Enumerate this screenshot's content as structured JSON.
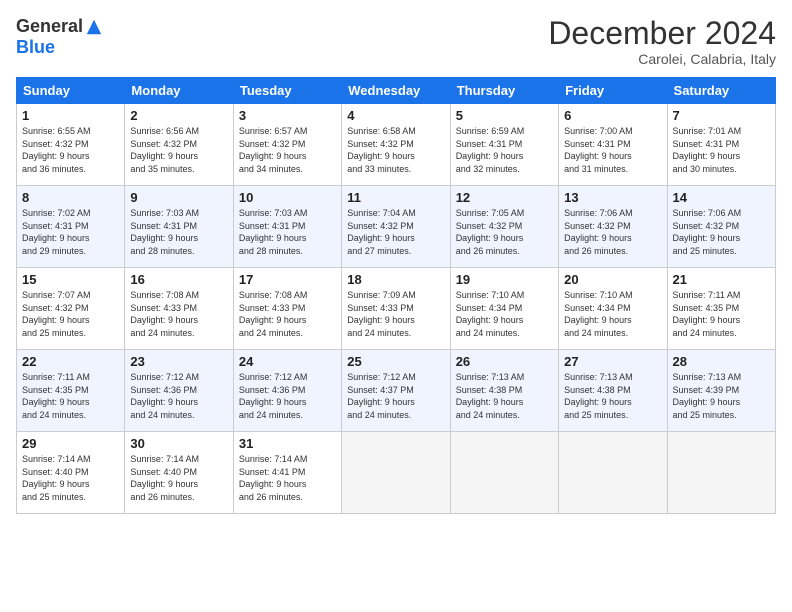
{
  "header": {
    "logo_general": "General",
    "logo_blue": "Blue",
    "month_title": "December 2024",
    "location": "Carolei, Calabria, Italy"
  },
  "days_of_week": [
    "Sunday",
    "Monday",
    "Tuesday",
    "Wednesday",
    "Thursday",
    "Friday",
    "Saturday"
  ],
  "weeks": [
    {
      "stripe": false,
      "days": [
        {
          "num": "1",
          "info": "Sunrise: 6:55 AM\nSunset: 4:32 PM\nDaylight: 9 hours\nand 36 minutes."
        },
        {
          "num": "2",
          "info": "Sunrise: 6:56 AM\nSunset: 4:32 PM\nDaylight: 9 hours\nand 35 minutes."
        },
        {
          "num": "3",
          "info": "Sunrise: 6:57 AM\nSunset: 4:32 PM\nDaylight: 9 hours\nand 34 minutes."
        },
        {
          "num": "4",
          "info": "Sunrise: 6:58 AM\nSunset: 4:32 PM\nDaylight: 9 hours\nand 33 minutes."
        },
        {
          "num": "5",
          "info": "Sunrise: 6:59 AM\nSunset: 4:31 PM\nDaylight: 9 hours\nand 32 minutes."
        },
        {
          "num": "6",
          "info": "Sunrise: 7:00 AM\nSunset: 4:31 PM\nDaylight: 9 hours\nand 31 minutes."
        },
        {
          "num": "7",
          "info": "Sunrise: 7:01 AM\nSunset: 4:31 PM\nDaylight: 9 hours\nand 30 minutes."
        }
      ]
    },
    {
      "stripe": true,
      "days": [
        {
          "num": "8",
          "info": "Sunrise: 7:02 AM\nSunset: 4:31 PM\nDaylight: 9 hours\nand 29 minutes."
        },
        {
          "num": "9",
          "info": "Sunrise: 7:03 AM\nSunset: 4:31 PM\nDaylight: 9 hours\nand 28 minutes."
        },
        {
          "num": "10",
          "info": "Sunrise: 7:03 AM\nSunset: 4:31 PM\nDaylight: 9 hours\nand 28 minutes."
        },
        {
          "num": "11",
          "info": "Sunrise: 7:04 AM\nSunset: 4:32 PM\nDaylight: 9 hours\nand 27 minutes."
        },
        {
          "num": "12",
          "info": "Sunrise: 7:05 AM\nSunset: 4:32 PM\nDaylight: 9 hours\nand 26 minutes."
        },
        {
          "num": "13",
          "info": "Sunrise: 7:06 AM\nSunset: 4:32 PM\nDaylight: 9 hours\nand 26 minutes."
        },
        {
          "num": "14",
          "info": "Sunrise: 7:06 AM\nSunset: 4:32 PM\nDaylight: 9 hours\nand 25 minutes."
        }
      ]
    },
    {
      "stripe": false,
      "days": [
        {
          "num": "15",
          "info": "Sunrise: 7:07 AM\nSunset: 4:32 PM\nDaylight: 9 hours\nand 25 minutes."
        },
        {
          "num": "16",
          "info": "Sunrise: 7:08 AM\nSunset: 4:33 PM\nDaylight: 9 hours\nand 24 minutes."
        },
        {
          "num": "17",
          "info": "Sunrise: 7:08 AM\nSunset: 4:33 PM\nDaylight: 9 hours\nand 24 minutes."
        },
        {
          "num": "18",
          "info": "Sunrise: 7:09 AM\nSunset: 4:33 PM\nDaylight: 9 hours\nand 24 minutes."
        },
        {
          "num": "19",
          "info": "Sunrise: 7:10 AM\nSunset: 4:34 PM\nDaylight: 9 hours\nand 24 minutes."
        },
        {
          "num": "20",
          "info": "Sunrise: 7:10 AM\nSunset: 4:34 PM\nDaylight: 9 hours\nand 24 minutes."
        },
        {
          "num": "21",
          "info": "Sunrise: 7:11 AM\nSunset: 4:35 PM\nDaylight: 9 hours\nand 24 minutes."
        }
      ]
    },
    {
      "stripe": true,
      "days": [
        {
          "num": "22",
          "info": "Sunrise: 7:11 AM\nSunset: 4:35 PM\nDaylight: 9 hours\nand 24 minutes."
        },
        {
          "num": "23",
          "info": "Sunrise: 7:12 AM\nSunset: 4:36 PM\nDaylight: 9 hours\nand 24 minutes."
        },
        {
          "num": "24",
          "info": "Sunrise: 7:12 AM\nSunset: 4:36 PM\nDaylight: 9 hours\nand 24 minutes."
        },
        {
          "num": "25",
          "info": "Sunrise: 7:12 AM\nSunset: 4:37 PM\nDaylight: 9 hours\nand 24 minutes."
        },
        {
          "num": "26",
          "info": "Sunrise: 7:13 AM\nSunset: 4:38 PM\nDaylight: 9 hours\nand 24 minutes."
        },
        {
          "num": "27",
          "info": "Sunrise: 7:13 AM\nSunset: 4:38 PM\nDaylight: 9 hours\nand 25 minutes."
        },
        {
          "num": "28",
          "info": "Sunrise: 7:13 AM\nSunset: 4:39 PM\nDaylight: 9 hours\nand 25 minutes."
        }
      ]
    },
    {
      "stripe": false,
      "days": [
        {
          "num": "29",
          "info": "Sunrise: 7:14 AM\nSunset: 4:40 PM\nDaylight: 9 hours\nand 25 minutes."
        },
        {
          "num": "30",
          "info": "Sunrise: 7:14 AM\nSunset: 4:40 PM\nDaylight: 9 hours\nand 26 minutes."
        },
        {
          "num": "31",
          "info": "Sunrise: 7:14 AM\nSunset: 4:41 PM\nDaylight: 9 hours\nand 26 minutes."
        },
        {
          "num": "",
          "info": ""
        },
        {
          "num": "",
          "info": ""
        },
        {
          "num": "",
          "info": ""
        },
        {
          "num": "",
          "info": ""
        }
      ]
    }
  ]
}
